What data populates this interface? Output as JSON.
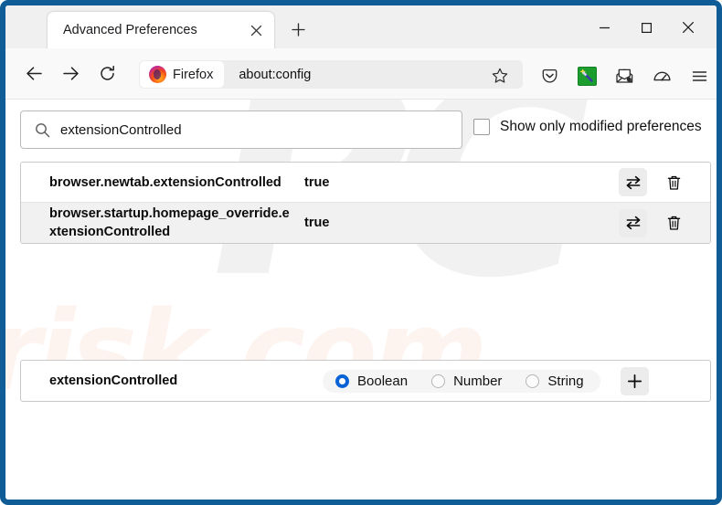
{
  "window": {
    "minimize_label": "–",
    "maximize_label": "☐",
    "close_label": "✕",
    "frame_color": "#0f5c97"
  },
  "tabs": {
    "active": {
      "title": "Advanced Preferences",
      "close_label": "✕"
    },
    "new_tab_label": "+"
  },
  "nav": {
    "back_label": "←",
    "forward_label": "→",
    "reload_label": "⟳",
    "star_label": "☆",
    "menu_label": "☰"
  },
  "urlbar": {
    "chip_label": "Firefox",
    "value": "about:config"
  },
  "toolbar_icons": [
    {
      "name": "pocket-icon",
      "label": ""
    },
    {
      "name": "extension-icon",
      "label": ""
    },
    {
      "name": "mail-icon",
      "label": ""
    },
    {
      "name": "speedometer-icon",
      "label": ""
    },
    {
      "name": "hamburger-menu-icon",
      "label": "☰"
    }
  ],
  "search": {
    "value": "extensionControlled",
    "placeholder": "Search preference name",
    "icon": "search-icon"
  },
  "show_modified": {
    "label": "Show only modified preferences",
    "checked": false
  },
  "preferences": {
    "rows": [
      {
        "name": "browser.newtab.extensionControlled",
        "value": "true",
        "toggle_label": "⇄",
        "delete_label": "🗑"
      },
      {
        "name": "browser.startup.homepage_override.extensionControlled",
        "value": "true",
        "toggle_label": "⇄",
        "delete_label": "🗑"
      }
    ]
  },
  "add_preference": {
    "name": "extensionControlled",
    "add_label": "+",
    "types": [
      {
        "label": "Boolean",
        "selected": true
      },
      {
        "label": "Number",
        "selected": false
      },
      {
        "label": "String",
        "selected": false
      }
    ]
  },
  "watermarks": {
    "primary": "PC",
    "secondary": "risk.com"
  },
  "colors": {
    "accent_blue": "#0a63d6",
    "frame_blue": "#0f5c97",
    "extension_green": "#1b9e2e"
  }
}
